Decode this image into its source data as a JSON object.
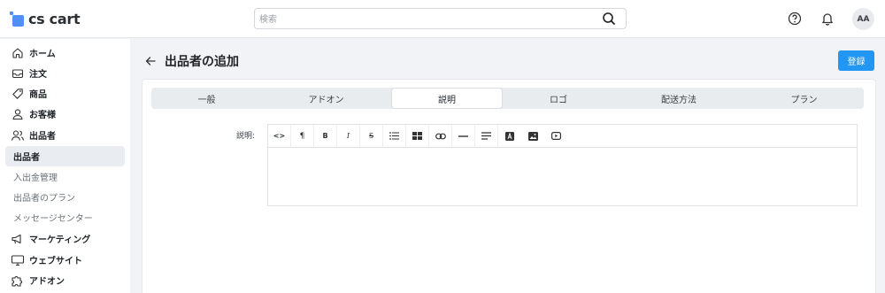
{
  "header": {
    "logo_text": "cs cart",
    "search_placeholder": "検索",
    "avatar_initials": "AA",
    "icons": [
      "search-icon",
      "help-icon",
      "bell-icon"
    ]
  },
  "sidebar": {
    "items": [
      {
        "label": "ホーム",
        "icon": "home-icon",
        "style": "bold"
      },
      {
        "label": "注文",
        "icon": "inbox-icon",
        "style": "bold"
      },
      {
        "label": "商品",
        "icon": "tag-icon",
        "style": "bold"
      },
      {
        "label": "お客様",
        "icon": "user-icon",
        "style": "bold"
      },
      {
        "label": "出品者",
        "icon": "users-icon",
        "style": "bold"
      },
      {
        "label": "出品者",
        "style": "active"
      },
      {
        "label": "入出金管理",
        "style": "sub"
      },
      {
        "label": "出品者のプラン",
        "style": "sub"
      },
      {
        "label": "メッセージセンター",
        "style": "sub"
      },
      {
        "label": "マーケティング",
        "icon": "megaphone-icon",
        "style": "bold"
      },
      {
        "label": "ウェブサイト",
        "icon": "monitor-icon",
        "style": "bold"
      },
      {
        "label": "アドオン",
        "icon": "puzzle-icon",
        "style": "bold"
      }
    ]
  },
  "page": {
    "title": "出品者の追加",
    "save_label": "登録"
  },
  "tabs": [
    {
      "label": "一般",
      "active": false
    },
    {
      "label": "アドオン",
      "active": false
    },
    {
      "label": "説明",
      "active": true
    },
    {
      "label": "ロゴ",
      "active": false
    },
    {
      "label": "配送方法",
      "active": false
    },
    {
      "label": "プラン",
      "active": false
    }
  ],
  "form": {
    "description_label": "説明:",
    "editor_value": "",
    "toolbar": {
      "code_label": "<>",
      "paragraph_label": "¶",
      "bold_label": "B",
      "italic_label": "I",
      "strike_label": "S",
      "tools": [
        "code-view-icon",
        "paragraph-icon",
        "bold-icon",
        "italic-icon",
        "strikethrough-icon",
        "bullet-list-icon",
        "table-icon",
        "link-icon",
        "horizontal-rule-icon",
        "align-icon",
        "font-color-icon",
        "image-icon",
        "video-icon"
      ]
    }
  },
  "colors": {
    "accent": "#2196f3",
    "logo": "#4f8ff7",
    "background": "#f1f3f6"
  }
}
